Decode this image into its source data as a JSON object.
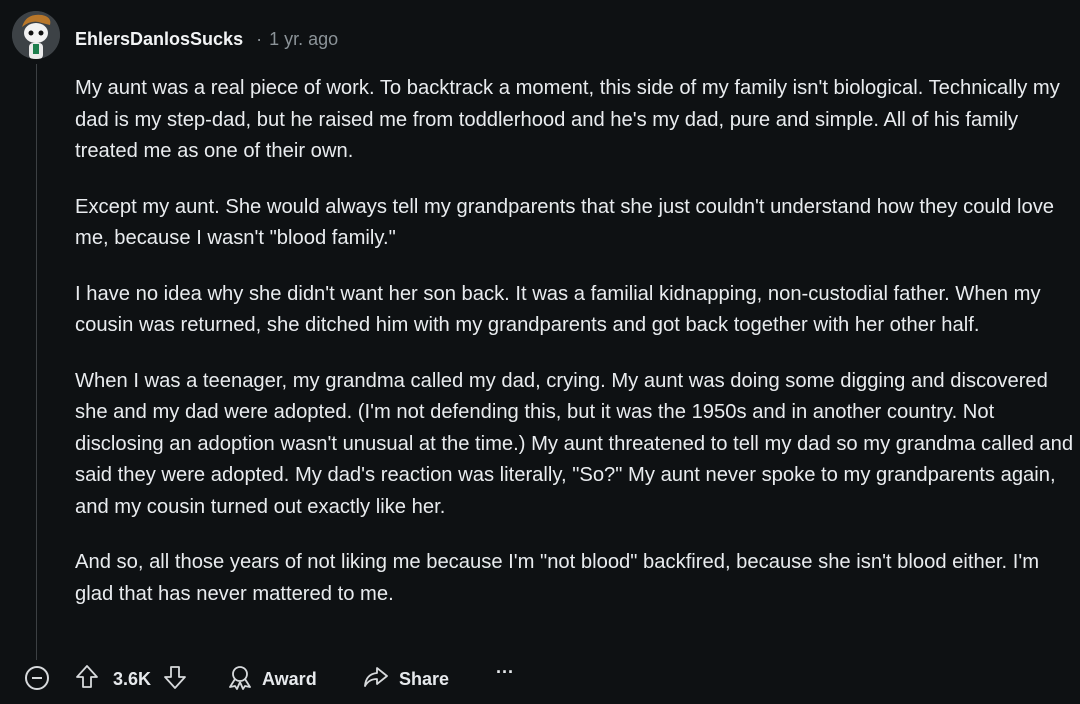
{
  "comment": {
    "username": "EhlersDanlosSucks",
    "separator": "·",
    "time": "1 yr. ago",
    "paragraphs": [
      "My aunt was a real piece of work. To backtrack a moment, this side of my family isn't biological. Technically my dad is my step-dad, but he raised me from toddlerhood and he's my dad, pure and simple. All of his family treated me as one of their own.",
      "Except my aunt. She would always tell my grandparents that she just couldn't understand how they could love me, because I wasn't \"blood family.\"",
      "I have no idea why she didn't want her son back. It was a familial kidnapping, non-custodial father. When my cousin was returned, she ditched him with my grandparents and got back together with her other half.",
      "When I was a teenager, my grandma called my dad, crying. My aunt was doing some digging and discovered she and my dad were adopted. (I'm not defending this, but it was the 1950s and in another country. Not disclosing an adoption wasn't unusual at the time.) My aunt threatened to tell my dad so my grandma called and said they were adopted. My dad's reaction was literally, \"So?\" My aunt never spoke to my grandparents again, and my cousin turned out exactly like her.",
      "And so, all those years of not liking me because I'm \"not blood\" backfired, because she isn't blood either. I'm glad that has never mattered to me."
    ]
  },
  "actions": {
    "score": "3.6K",
    "award_label": "Award",
    "share_label": "Share",
    "more_label": "···"
  },
  "icons": {
    "collapse": "collapse-icon",
    "upvote": "upvote-icon",
    "downvote": "downvote-icon",
    "award": "award-icon",
    "share": "share-icon",
    "more": "more-icon"
  }
}
